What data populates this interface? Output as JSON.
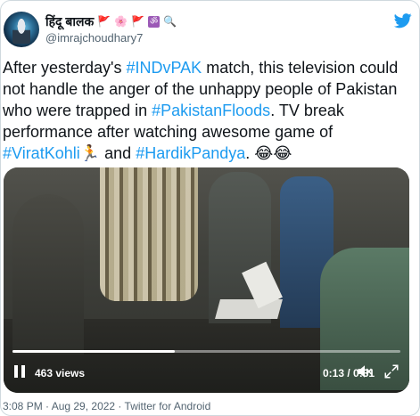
{
  "author": {
    "display_name": "हिंदू बालक",
    "emojis": [
      "🚩",
      "🌸",
      "🚩",
      "ॐ",
      "🔍"
    ],
    "handle": "@imrajchoudhary7"
  },
  "tweet": {
    "segments": [
      {
        "text": "After yesterday's ",
        "type": "text"
      },
      {
        "text": "#INDvPAK",
        "type": "hashtag"
      },
      {
        "text": " match, this television could not handle the anger of the unhappy people of Pakistan who were trapped in ",
        "type": "text"
      },
      {
        "text": "#PakistanFloods",
        "type": "hashtag"
      },
      {
        "text": ". TV break performance after watching awesome game of ",
        "type": "text"
      },
      {
        "text": "#ViratKohli",
        "type": "hashtag"
      },
      {
        "text": "🏃",
        "type": "emoji"
      },
      {
        "text": " and ",
        "type": "text"
      },
      {
        "text": "#HardikPandya",
        "type": "hashtag"
      },
      {
        "text": ". 😂😂",
        "type": "text"
      }
    ]
  },
  "video": {
    "views_label": "463 views",
    "time_label": "0:13 / 0:31",
    "progress_fraction": 0.4194,
    "controls": {
      "pause_icon": "pause-icon",
      "mute_icon": "volume-muted-icon",
      "fullscreen_icon": "fullscreen-icon"
    }
  },
  "meta": {
    "line": "3:08 PM · Aug 29, 2022 · Twitter for Android"
  },
  "colors": {
    "hashtag": "#1d9bf0",
    "twitter_blue": "#1d9bf0",
    "secondary_text": "#536471",
    "border": "#cfd9de"
  }
}
